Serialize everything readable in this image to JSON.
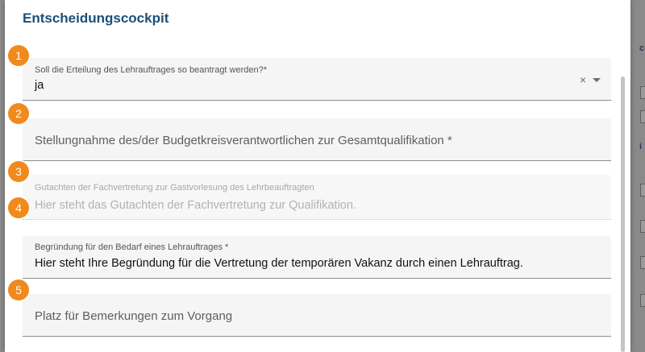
{
  "dialog": {
    "title": "Entscheidungscockpit"
  },
  "fields": [
    {
      "number": "1",
      "label": "Soll die Erteilung des Lehrauftrages so beantragt werden?*",
      "value": "ja",
      "clear_icon": "close-icon",
      "dropdown_icon": "chevron-down-icon"
    },
    {
      "number": "2",
      "placeholder": "Stellungnahme des/der Budgetkreisverantwortlichen zur Gesamtqualifikation *"
    },
    {
      "number": "3",
      "label": "Gutachten der Fachvertretung zur Gastvorlesung des Lehrbeauftragten",
      "value": "Hier steht das Gutachten der Fachvertretung zur Qualifikation.",
      "disabled": true
    },
    {
      "number": "4",
      "label": "Begründung für den Bedarf eines Lehrauftrages *",
      "value": "Hier steht Ihre Begründung für die Vertretung der temporären Vakanz durch einen Lehrauftrag."
    },
    {
      "number": "5",
      "placeholder": "Platz für Bemerkungen zum Vorgang"
    }
  ],
  "colors": {
    "accent": "#1b4f78",
    "badge": "#f08a1c"
  }
}
